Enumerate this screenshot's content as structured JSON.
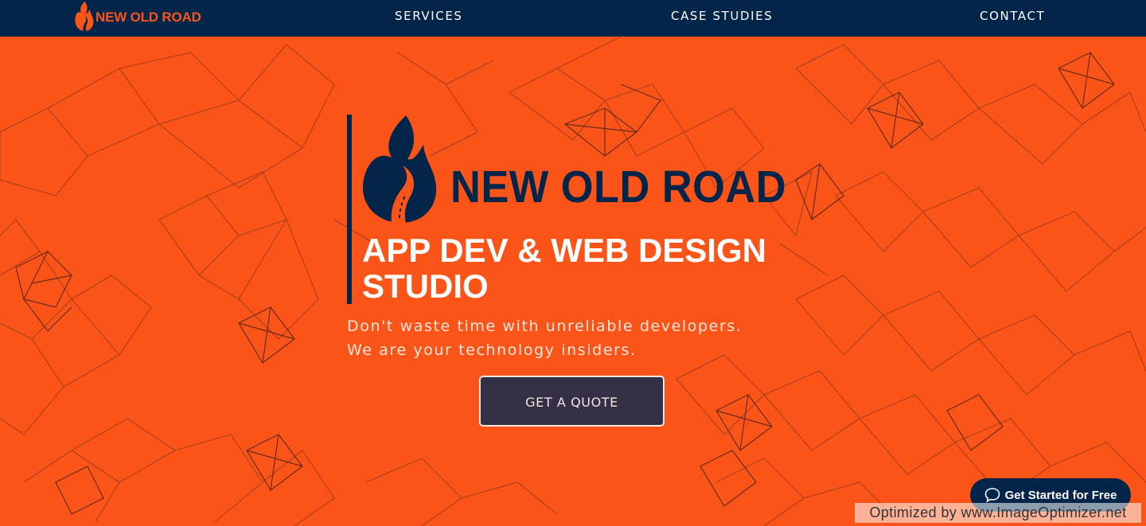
{
  "colors": {
    "brand_orange": "#fb5419",
    "navy": "#03254a",
    "cta_background": "#333046",
    "text_light": "#fde6dc"
  },
  "nav": {
    "logo_icon": "flame-road-icon",
    "logo_text": "NEW OLD ROAD",
    "links": [
      "SERVICES",
      "CASE STUDIES",
      "CONTACT"
    ]
  },
  "hero": {
    "logo_icon": "flame-road-icon",
    "brand": "NEW OLD ROAD",
    "headline": "APP DEV & WEB DESIGN STUDIO",
    "sub_line_1": "Don't waste time with unreliable developers.",
    "sub_line_2": "We are your technology insiders.",
    "cta_label": "GET A QUOTE"
  },
  "chat_widget": {
    "icon": "speech-bubble-icon",
    "label": "Get Started for Free"
  },
  "watermark": "Optimized by www.ImageOptimizer.net"
}
